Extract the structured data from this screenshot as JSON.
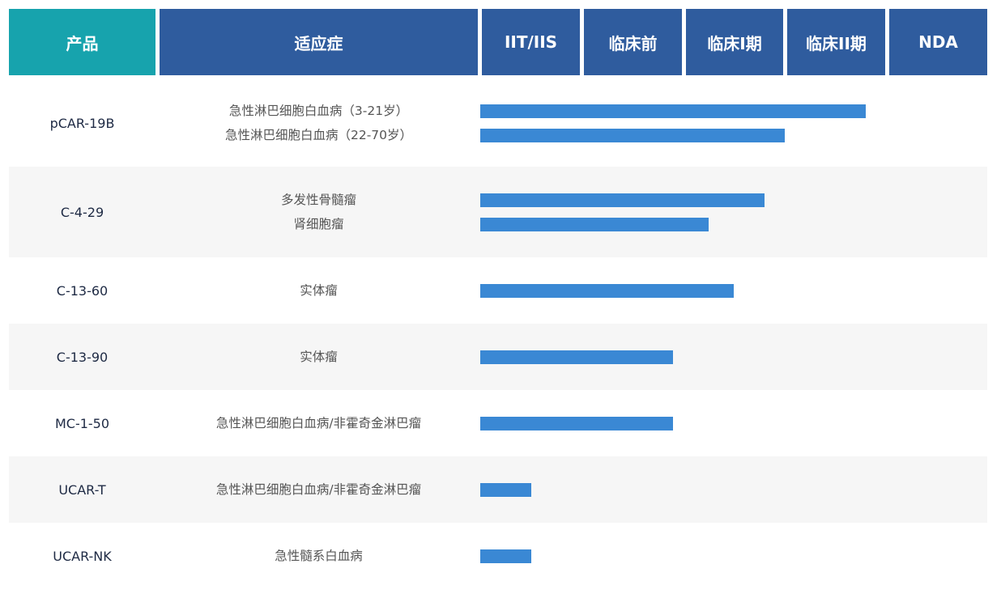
{
  "colors": {
    "product_header": "#17a3ad",
    "header": "#2f5c9e",
    "bar": "#3a88d4",
    "stripe": "#f6f6f6"
  },
  "header": {
    "product": "产品",
    "indication": "适应症",
    "stages": [
      "IIT/IIS",
      "临床前",
      "临床I期",
      "临床II期",
      "NDA"
    ]
  },
  "chart_data": {
    "type": "bar",
    "orientation": "horizontal",
    "stage_scale": [
      "IIT/IIS",
      "临床前",
      "临床I期",
      "临床II期",
      "NDA"
    ],
    "xlim": [
      0,
      5
    ],
    "rows": [
      {
        "product": "pCAR-19B",
        "indications": [
          {
            "name": "急性淋巴细胞白血病（3-21岁）",
            "value": 3.8
          },
          {
            "name": "急性淋巴细胞白血病（22-70岁）",
            "value": 3.0
          }
        ]
      },
      {
        "product": "C-4-29",
        "indications": [
          {
            "name": "多发性骨髓瘤",
            "value": 2.8
          },
          {
            "name": "肾细胞瘤",
            "value": 2.25
          }
        ]
      },
      {
        "product": "C-13-60",
        "indications": [
          {
            "name": "实体瘤",
            "value": 2.5
          }
        ]
      },
      {
        "product": "C-13-90",
        "indications": [
          {
            "name": "实体瘤",
            "value": 1.9
          }
        ]
      },
      {
        "product": "MC-1-50",
        "indications": [
          {
            "name": "急性淋巴细胞白血病/非霍奇金淋巴瘤",
            "value": 1.9
          }
        ]
      },
      {
        "product": "UCAR-T",
        "indications": [
          {
            "name": "急性淋巴细胞白血病/非霍奇金淋巴瘤",
            "value": 0.5
          }
        ]
      },
      {
        "product": "UCAR-NK",
        "indications": [
          {
            "name": "急性髓系白血病",
            "value": 0.5
          }
        ]
      }
    ]
  }
}
